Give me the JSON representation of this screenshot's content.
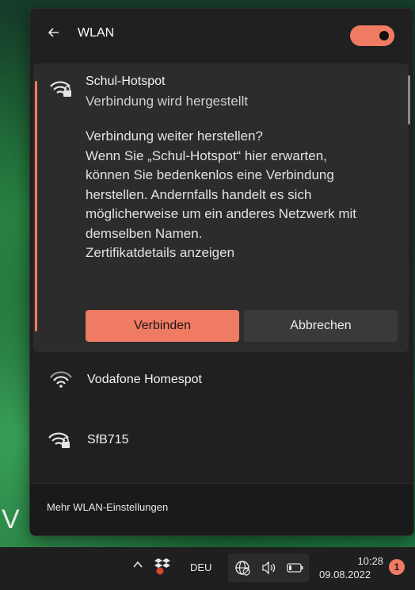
{
  "panel": {
    "title": "WLAN",
    "wifi_toggle_on": true
  },
  "connecting_network": {
    "name": "Schul-Hotspot",
    "status": "Verbindung wird hergestellt",
    "icon": "wifi-secured-icon",
    "message_lines": [
      "Verbindung weiter herstellen?",
      "Wenn Sie „Schul-Hotspot“ hier erwarten,",
      "können Sie bedenkenlos eine Verbindung",
      "herstellen. Andernfalls handelt es sich",
      "möglicherweise um ein anderes Netzwerk mit",
      "demselben Namen.",
      "Zertifikatdetails anzeigen"
    ],
    "connect_label": "Verbinden",
    "cancel_label": "Abbrechen"
  },
  "networks": [
    {
      "name": "Vodafone Homespot",
      "icon": "wifi-open-icon"
    },
    {
      "name": "SfB715",
      "icon": "wifi-secured-icon"
    }
  ],
  "footer": {
    "link": "Mehr WLAN-Einstellungen"
  },
  "wallpaper_text": "V",
  "taskbar": {
    "language": "DEU",
    "time": "10:28",
    "date": "09.08.2022",
    "notification_count": "1",
    "tray_icons": [
      "chevron-up-icon",
      "dropbox-icon",
      "network-icon",
      "volume-icon",
      "battery-icon"
    ]
  },
  "colors": {
    "accent": "#f07b63",
    "panel_bg": "#202020",
    "card_bg": "#2c2c2c"
  }
}
